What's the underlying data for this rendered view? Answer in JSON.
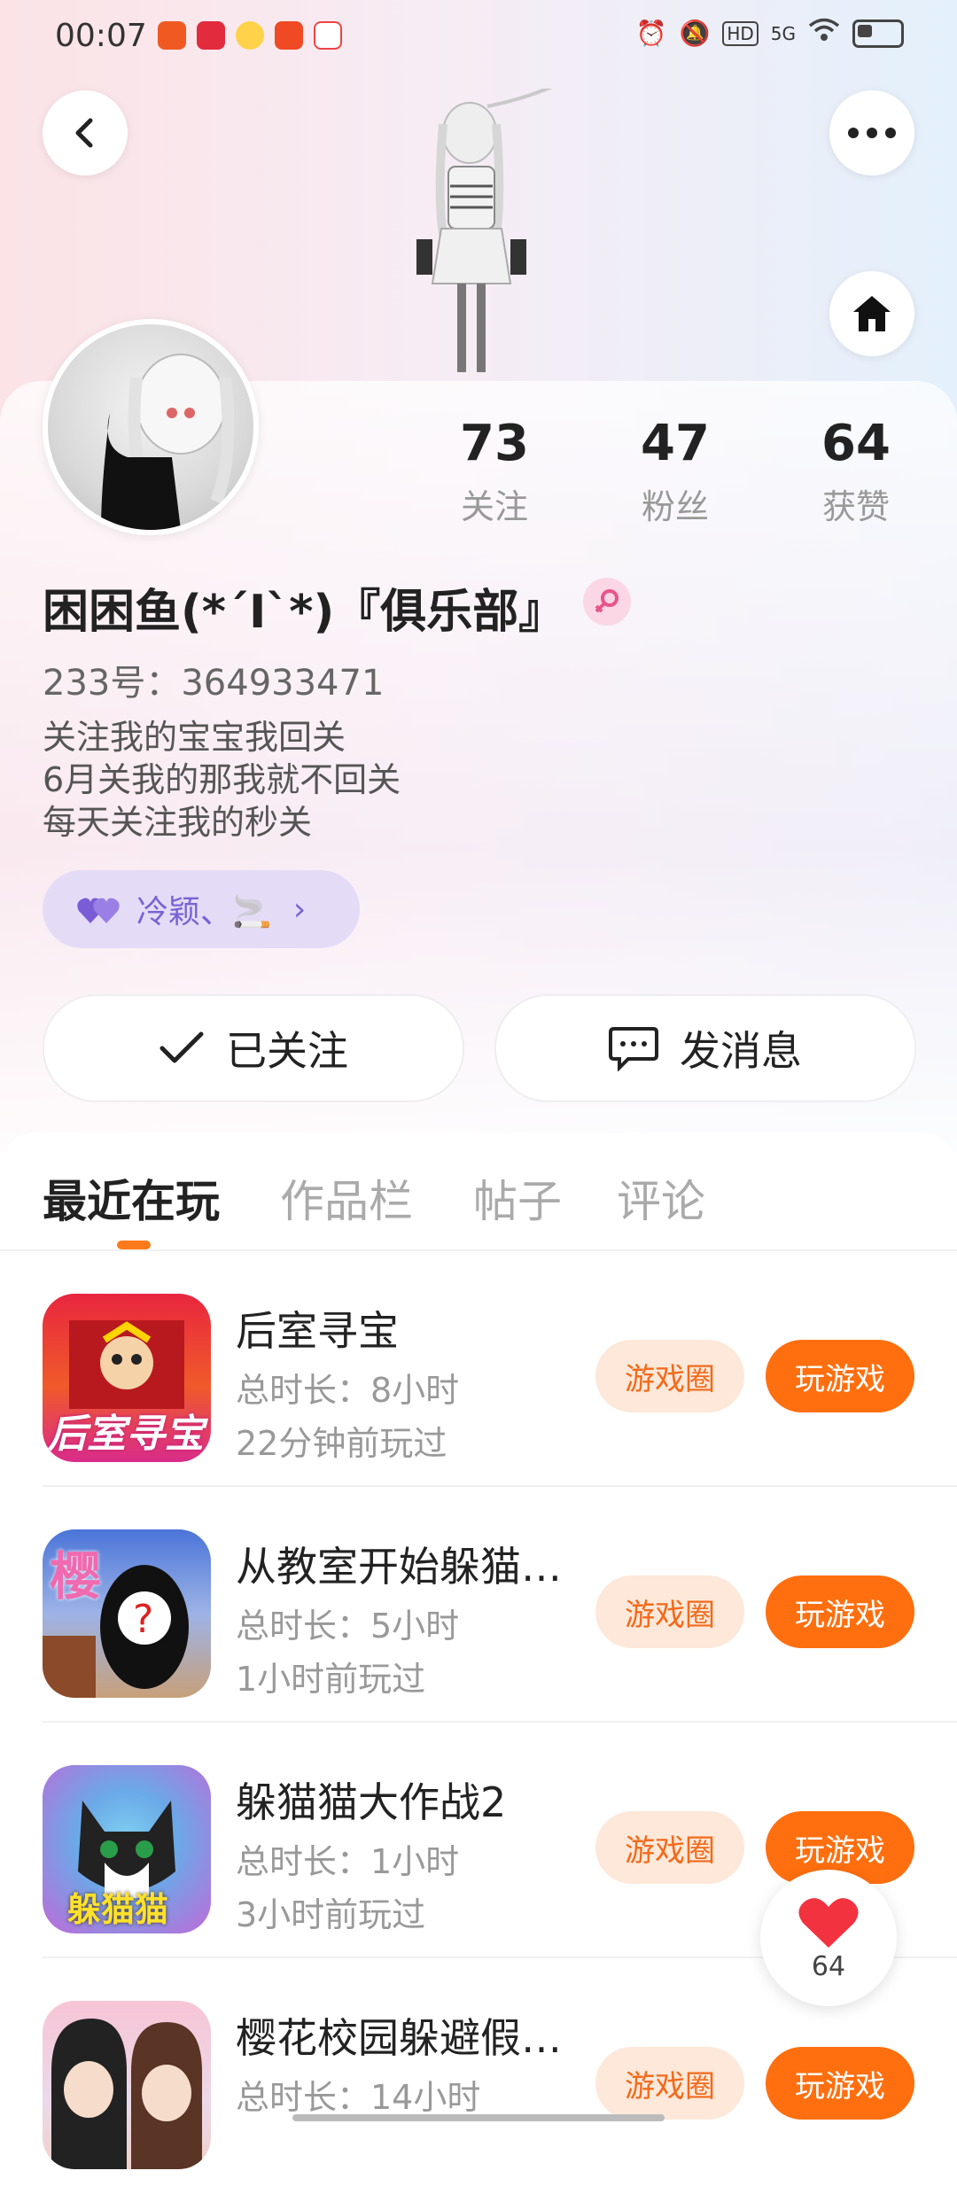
{
  "status_bar": {
    "time": "00:07",
    "network": "5G"
  },
  "profile": {
    "stats": [
      {
        "value": "73",
        "label": "关注"
      },
      {
        "value": "47",
        "label": "粉丝"
      },
      {
        "value": "64",
        "label": "获赞"
      }
    ],
    "username": "困困鱼(*´I`*)『俱乐部』",
    "uid": "233号：364933471",
    "bio": [
      "关注我的宝宝我回关",
      "6月关我的那我就不回关",
      "每天关注我的秒关"
    ],
    "tag_label": "冷颖、🚬"
  },
  "actions": {
    "follow_label": "已关注",
    "message_label": "发消息"
  },
  "tabs": [
    "最近在玩",
    "作品栏",
    "帖子",
    "评论"
  ],
  "games": [
    {
      "name": "后室寻宝",
      "duration": "总时长：8小时",
      "last_played": "22分钟前玩过",
      "circle_label": "游戏圈",
      "play_label": "玩游戏",
      "icon_text": "后室寻宝"
    },
    {
      "name": "从教室开始躲猫…",
      "duration": "总时长：5小时",
      "last_played": "1小时前玩过",
      "circle_label": "游戏圈",
      "play_label": "玩游戏",
      "icon_text": "樱"
    },
    {
      "name": "躲猫猫大作战2",
      "duration": "总时长：1小时",
      "last_played": "3小时前玩过",
      "circle_label": "游戏圈",
      "play_label": "玩游戏",
      "icon_text": "躲猫猫"
    },
    {
      "name": "樱花校园躲避假…",
      "duration": "总时长：14小时",
      "last_played": "",
      "circle_label": "游戏圈",
      "play_label": "玩游戏",
      "icon_text": ""
    }
  ],
  "like_float": {
    "count": "64"
  },
  "colors": {
    "accent": "#ff6f0f",
    "accent_light": "#fde8d9",
    "tag_bg": "#e4dcf7",
    "tag_text": "#7a62d4"
  }
}
